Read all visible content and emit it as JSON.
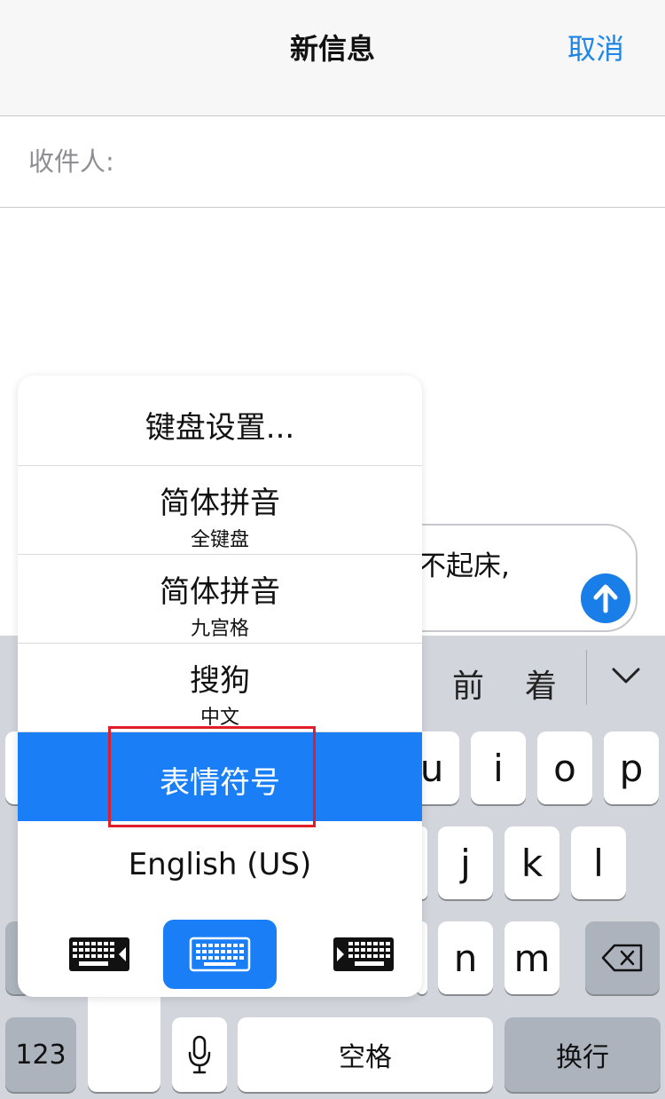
{
  "header": {
    "title": "新信息",
    "cancel_label": "取消"
  },
  "recipient": {
    "label": "收件人:",
    "value": ""
  },
  "compose": {
    "text": "不起床,",
    "send_icon": "arrow-up-icon"
  },
  "candidates": {
    "items": [
      "前",
      "着"
    ],
    "toggle_icon": "chevron-down-icon"
  },
  "keyboard": {
    "row1": [
      "u",
      "i",
      "o",
      "p"
    ],
    "row2": [
      "j",
      "k",
      "l"
    ],
    "row3": [
      "n",
      "m"
    ],
    "numbers_label": "123",
    "space_label": "空格",
    "return_label": "换行",
    "mic_icon": "microphone-icon",
    "delete_icon": "backspace-icon"
  },
  "input_menu": {
    "settings_label": "键盘设置...",
    "items": [
      {
        "label": "简体拼音",
        "sub": "全键盘"
      },
      {
        "label": "简体拼音",
        "sub": "九宫格"
      },
      {
        "label": "搜狗",
        "sub": "中文"
      },
      {
        "label": "表情符号",
        "sub": ""
      },
      {
        "label": "English (US)",
        "sub": ""
      }
    ],
    "selected_index": 3,
    "layout_options": [
      "keyboard-left-icon",
      "keyboard-full-icon",
      "keyboard-right-icon"
    ],
    "selected_layout": "keyboard-full-icon"
  },
  "colors": {
    "accent": "#1a7ff7",
    "link": "#1f86e6",
    "highlight_box": "#e01d2a",
    "keyboard_bg": "#d2d5db"
  }
}
